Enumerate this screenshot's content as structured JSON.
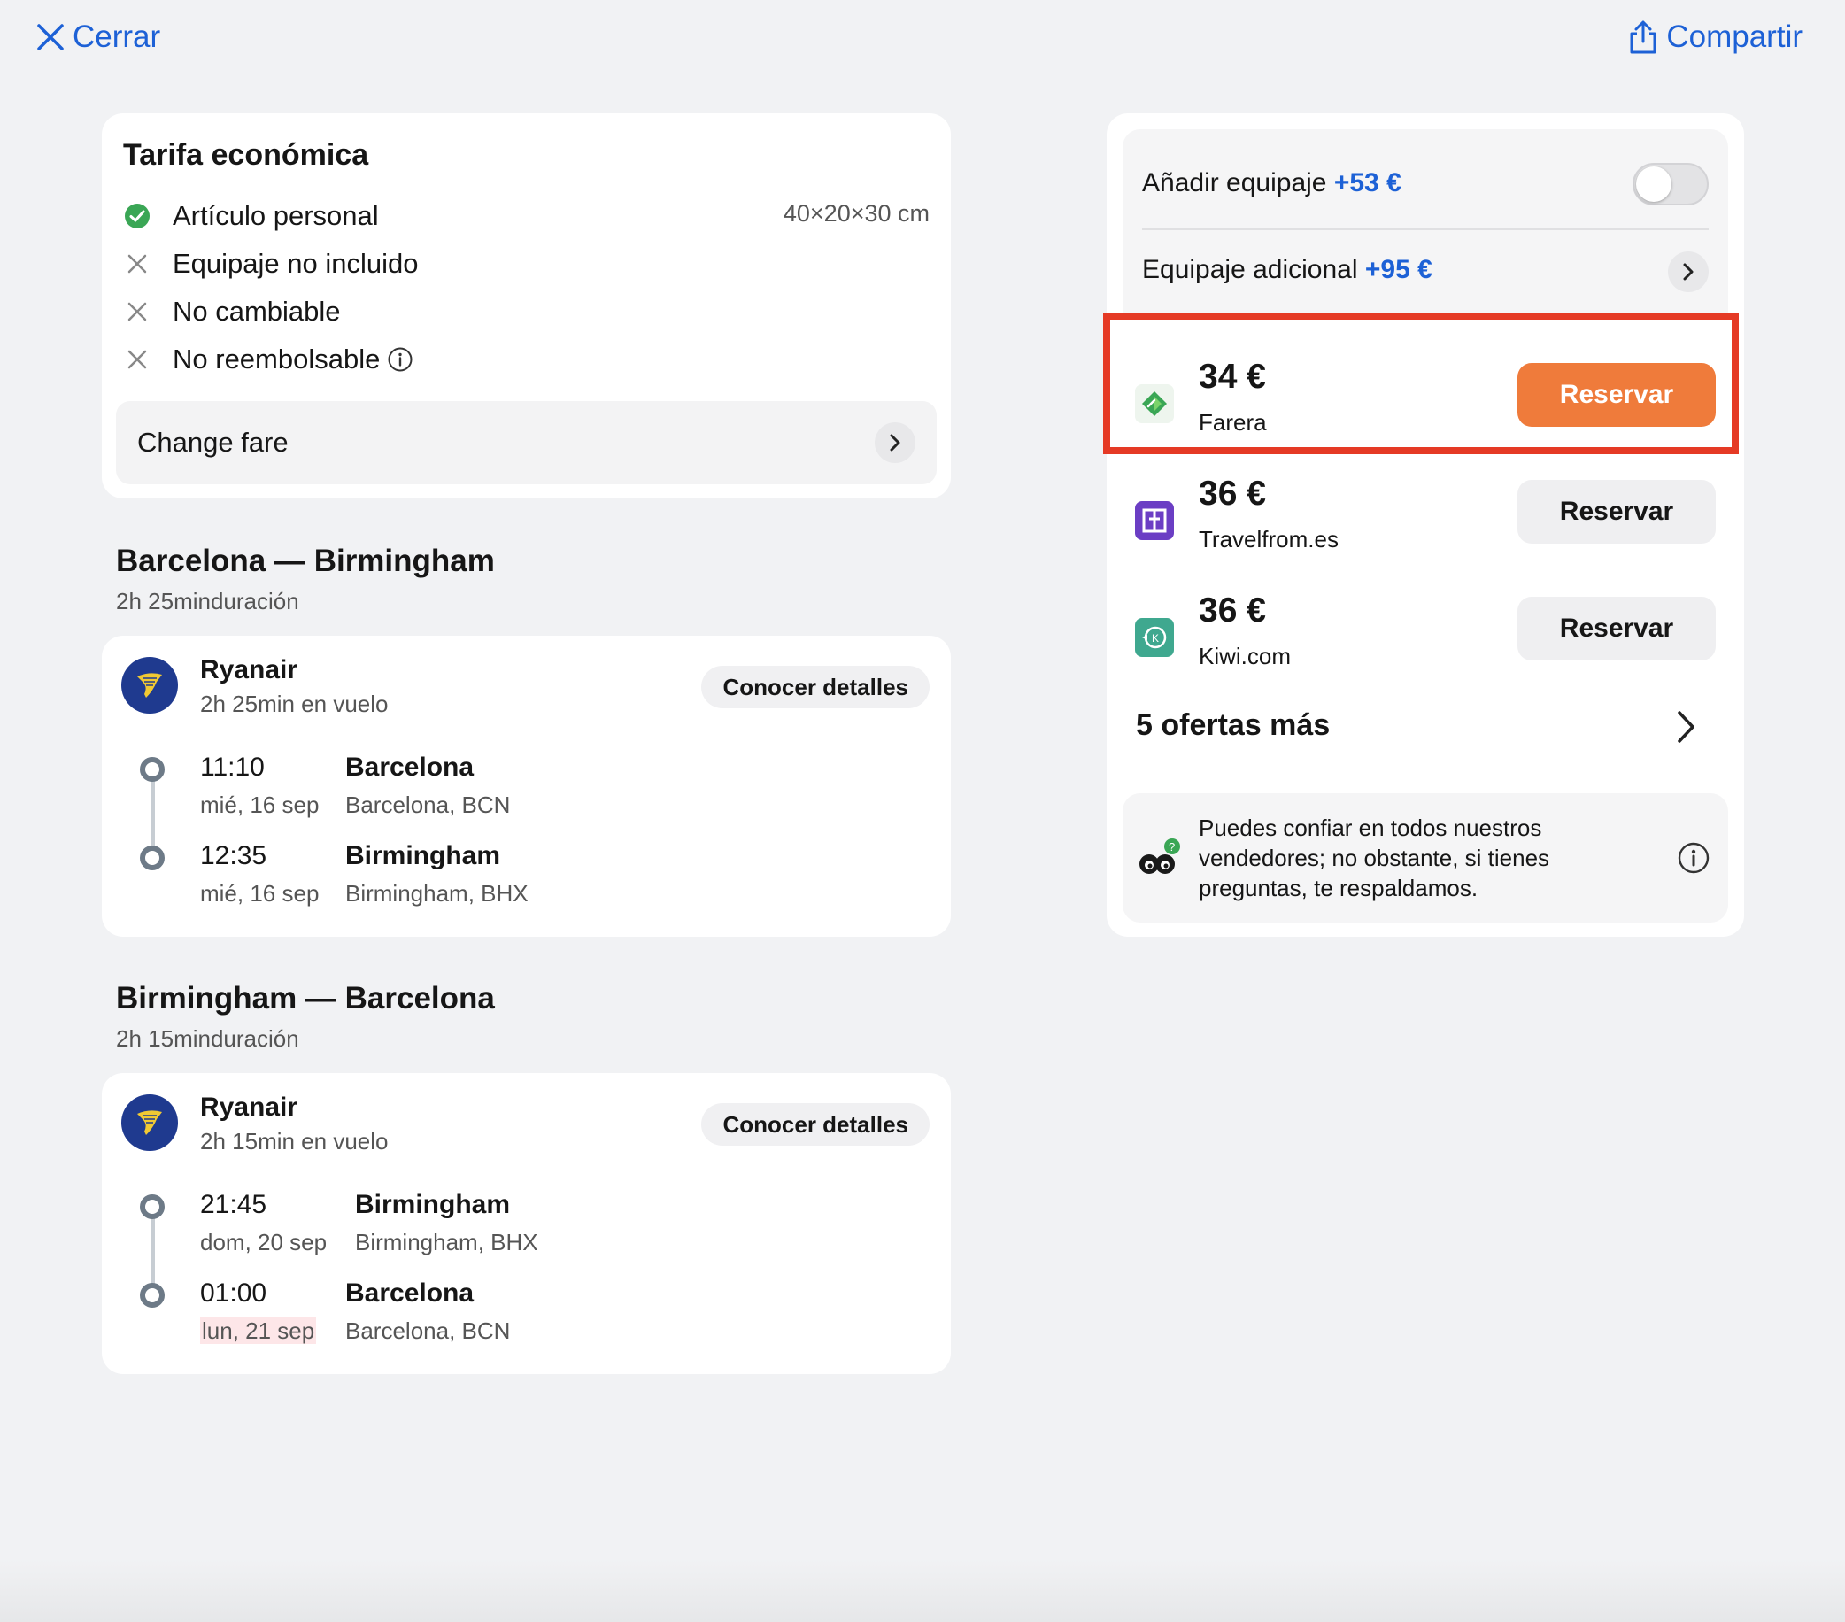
{
  "topbar": {
    "close_label": "Cerrar",
    "share_label": "Compartir"
  },
  "fare": {
    "title": "Tarifa económica",
    "items": [
      {
        "label": "Artículo personal",
        "included": true,
        "detail": "40×20×30 cm"
      },
      {
        "label": "Equipaje no incluido",
        "included": false
      },
      {
        "label": "No cambiable",
        "included": false
      },
      {
        "label": "No reembolsable",
        "included": false,
        "info": true
      }
    ],
    "change_fare_label": "Change fare"
  },
  "outbound": {
    "route": "Barcelona — Birmingham",
    "duration": "2h 25minduración",
    "airline": "Ryanair",
    "flight_time": "2h 25min en vuelo",
    "details_label": "Conocer detalles",
    "depart": {
      "time": "11:10",
      "date": "mié, 16 sep",
      "city": "Barcelona",
      "airport": "Barcelona, BCN"
    },
    "arrive": {
      "time": "12:35",
      "date": "mié, 16 sep",
      "city": "Birmingham",
      "airport": "Birmingham, BHX"
    }
  },
  "inbound": {
    "route": "Birmingham — Barcelona",
    "duration": "2h 15minduración",
    "airline": "Ryanair",
    "flight_time": "2h 15min en vuelo",
    "details_label": "Conocer detalles",
    "depart": {
      "time": "21:45",
      "date": "dom, 20 sep",
      "city": "Birmingham",
      "airport": "Birmingham, BHX"
    },
    "arrive": {
      "time": "01:00",
      "date": "lun, 21 sep",
      "city": "Barcelona",
      "airport": "Barcelona, BCN"
    }
  },
  "baggage": {
    "add_label": "Añadir equipaje",
    "add_price": "+53 €",
    "add_enabled": false,
    "extra_label": "Equipaje adicional",
    "extra_price": "+95 €"
  },
  "offers": [
    {
      "price": "34 €",
      "seller": "Farera",
      "button": "Reservar",
      "highlighted": true,
      "logo": "farera-logo"
    },
    {
      "price": "36 €",
      "seller": "Travelfrom.es",
      "button": "Reservar",
      "highlighted": false,
      "logo": "travelfrom-logo"
    },
    {
      "price": "36 €",
      "seller": "Kiwi.com",
      "button": "Reservar",
      "highlighted": false,
      "logo": "kiwi-logo"
    }
  ],
  "more_offers_label": "5 ofertas más",
  "trust_text": "Puedes confiar en todos nuestros vendedores; no obstante, si tienes preguntas, te respaldamos.",
  "colors": {
    "accent": "#1d61d6",
    "book_primary": "#ef7b3b",
    "highlight_border": "#e53a25",
    "included_check": "#3aa655"
  }
}
